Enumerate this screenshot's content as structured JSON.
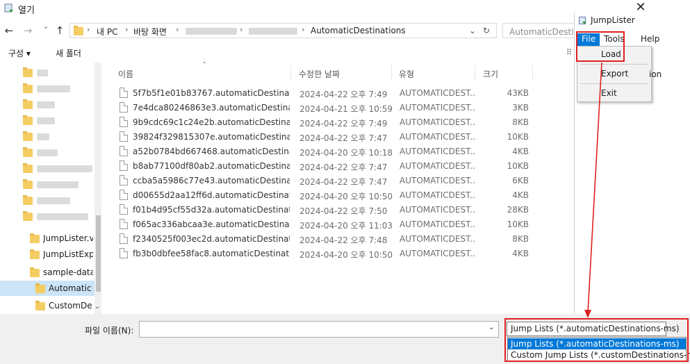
{
  "window": {
    "title": "열기",
    "close_glyph": "✕"
  },
  "nav": {
    "back": "←",
    "forward": "→",
    "history": "˅",
    "up": "↑",
    "breadcrumbs": [
      "내 PC",
      "바탕 화면",
      "AutomaticDestinations"
    ],
    "refresh": "↻",
    "dropdown": "⌄",
    "search_placeholder": "AutomaticDestinations 검색"
  },
  "toolbar": {
    "organize": "구성 ▾",
    "new_folder": "새 폴더"
  },
  "navpane": {
    "items": [
      {
        "label": "JumpLister.v."
      },
      {
        "label": "JumpListExpl"
      },
      {
        "label": "sample-data"
      },
      {
        "label": "AutomaticD"
      },
      {
        "label": "CustomDes"
      }
    ]
  },
  "list": {
    "columns": {
      "name": "이름",
      "date": "수정한 날짜",
      "type": "유형",
      "size": "크기"
    },
    "rows": [
      {
        "name": "5f7b5f1e01b83767.automaticDestinatio...",
        "date": "2024-04-22 오후 7:49",
        "type": "AUTOMATICDEST...",
        "size": "43KB"
      },
      {
        "name": "7e4dca80246863e3.automaticDestinati...",
        "date": "2024-04-21 오후 10:59",
        "type": "AUTOMATICDEST...",
        "size": "3KB"
      },
      {
        "name": "9b9cdc69c1c24e2b.automaticDestinati...",
        "date": "2024-04-22 오후 7:49",
        "type": "AUTOMATICDEST...",
        "size": "8KB"
      },
      {
        "name": "39824f329815307e.automaticDestinati...",
        "date": "2024-04-22 오후 7:47",
        "type": "AUTOMATICDEST...",
        "size": "10KB"
      },
      {
        "name": "a52b0784bd667468.automaticDestinati...",
        "date": "2024-04-20 오후 10:18",
        "type": "AUTOMATICDEST...",
        "size": "4KB"
      },
      {
        "name": "b8ab77100df80ab2.automaticDestinati...",
        "date": "2024-04-22 오후 7:47",
        "type": "AUTOMATICDEST...",
        "size": "10KB"
      },
      {
        "name": "ccba5a5986c77e43.automaticDestinati...",
        "date": "2024-04-22 오후 7:47",
        "type": "AUTOMATICDEST...",
        "size": "6KB"
      },
      {
        "name": "d00655d2aa12ff6d.automaticDestinatio...",
        "date": "2024-04-20 오후 10:50",
        "type": "AUTOMATICDEST...",
        "size": "4KB"
      },
      {
        "name": "f01b4d95cf55d32a.automaticDestinati...",
        "date": "2024-04-22 오후 7:50",
        "type": "AUTOMATICDEST...",
        "size": "28KB"
      },
      {
        "name": "f065ac336abcaa3e.automaticDestinatio...",
        "date": "2024-04-20 오후 11:03",
        "type": "AUTOMATICDEST...",
        "size": "10KB"
      },
      {
        "name": "f2340525f003ec2d.automaticDestinati...",
        "date": "2024-04-22 오후 7:48",
        "type": "AUTOMATICDEST...",
        "size": "8KB"
      },
      {
        "name": "fb3b0dbfee58fac8.automaticDestination...",
        "date": "2024-04-20 오후 10:50",
        "type": "AUTOMATICDEST...",
        "size": "4KB"
      }
    ]
  },
  "bottom": {
    "filename_label": "파일 이름(N):",
    "filename_value": "",
    "filter_selected": "Jump Lists (*.automaticDestinations-ms)",
    "filter_options": [
      "Jump Lists (*.automaticDestinations-ms)",
      "Custom Jump Lists (*.customDestinations-ms)"
    ]
  },
  "jumplister": {
    "title": "JumpLister",
    "menus": [
      "File",
      "Tools",
      "Help"
    ],
    "file_menu": [
      "Load",
      "Export",
      "Exit"
    ],
    "partial_text": "ion"
  },
  "colors": {
    "highlight": "#0078d7",
    "annotation_red": "#e02020",
    "folder": "#f4cd62"
  },
  "icons": [
    "dialog-app-icon",
    "folder-icon",
    "file-icon",
    "jumplister-app-icon"
  ]
}
